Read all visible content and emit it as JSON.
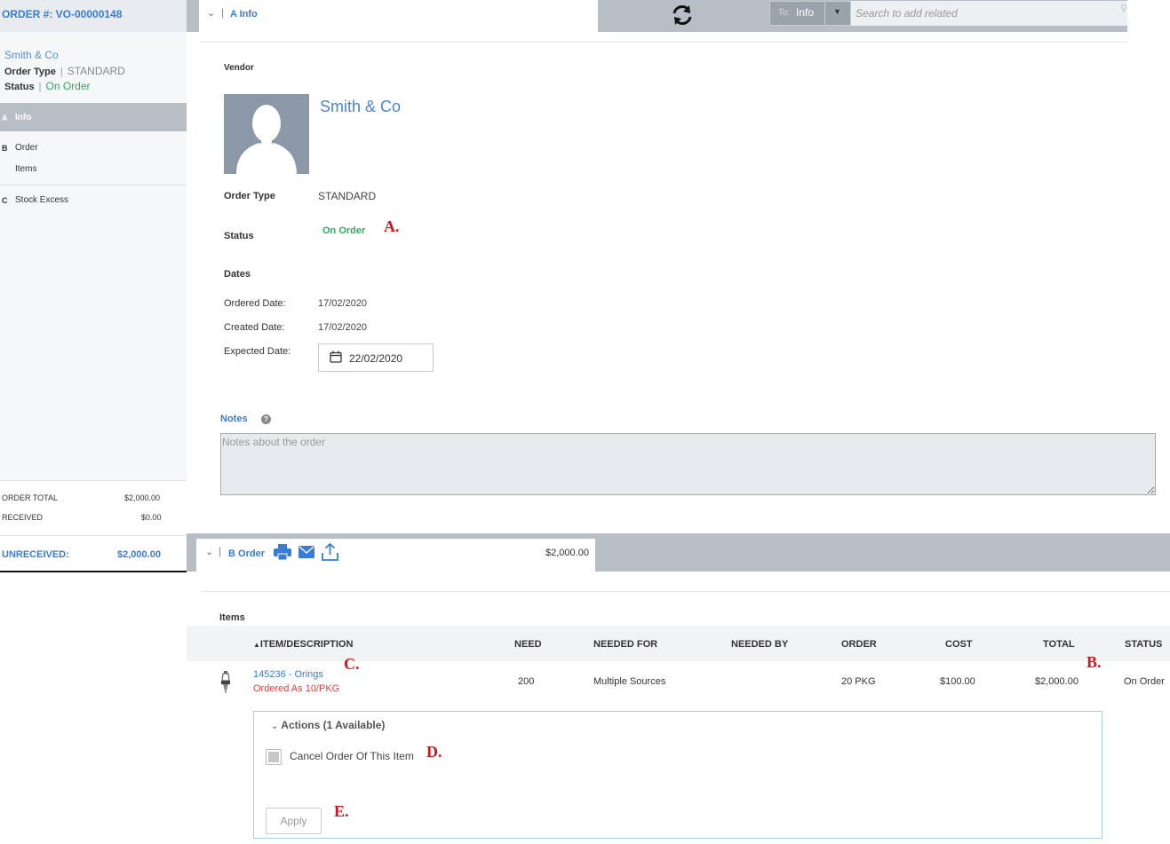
{
  "sidebar": {
    "order_label": "ORDER #: VO-00000148",
    "vendor": "Smith & Co",
    "order_type_label": "Order Type",
    "order_type_value": "STANDARD",
    "status_label": "Status",
    "status_value": "On Order",
    "nav": [
      {
        "letter": "A",
        "label": "Info",
        "active": true
      },
      {
        "letter": "B",
        "label": "Order"
      },
      {
        "letter": "",
        "label": "Items"
      },
      {
        "letter": "C",
        "label": "Stock Excess"
      }
    ],
    "totals": {
      "order_total_label": "ORDER TOTAL",
      "order_total_value": "$2,000.00",
      "received_label": "RECEIVED",
      "received_value": "$0.00",
      "unreceived_label": "UNRECEIVED:",
      "unreceived_value": "$2,000.00"
    }
  },
  "topbar": {
    "section_letter": "A",
    "section_title": "Info",
    "to_label": "To:",
    "to_value": "Info",
    "search_placeholder": "Search to add related"
  },
  "info": {
    "vendor_label": "Vendor",
    "vendor_name": "Smith & Co",
    "order_type_label": "Order Type",
    "order_type_value": "STANDARD",
    "status_label": "Status",
    "status_value": "On Order",
    "dates_label": "Dates",
    "ordered_label": "Ordered Date:",
    "ordered_value": "17/02/2020",
    "created_label": "Created Date:",
    "created_value": "17/02/2020",
    "expected_label": "Expected Date:",
    "expected_value": "22/02/2020",
    "notes_label": "Notes",
    "notes_placeholder": "Notes about the order"
  },
  "order_section": {
    "letter": "B",
    "title": "Order",
    "total": "$2,000.00",
    "items_label": "Items",
    "columns": [
      "ITEM/DESCRIPTION",
      "NEED",
      "NEEDED FOR",
      "NEEDED BY",
      "ORDER",
      "COST",
      "TOTAL",
      "STATUS"
    ],
    "row": {
      "item": "145236 - Orings",
      "sub": "Ordered As 10/PKG",
      "need": "200",
      "needed_for": "Multiple Sources",
      "needed_by": "",
      "order": "20 PKG",
      "cost": "$100.00",
      "total": "$2,000.00",
      "status": "On Order"
    },
    "actions": {
      "title": "Actions (1 Available)",
      "checkbox_label": "Cancel Order Of This Item",
      "apply_label": "Apply"
    }
  },
  "annotations": {
    "a": "A.",
    "b": "B.",
    "c": "C.",
    "d": "D.",
    "e": "E."
  },
  "colors": {
    "accent": "#3a7bd5",
    "status_green": "#36a860",
    "annotation_red": "#d0161c",
    "bar_gray": "#b8bec5"
  }
}
